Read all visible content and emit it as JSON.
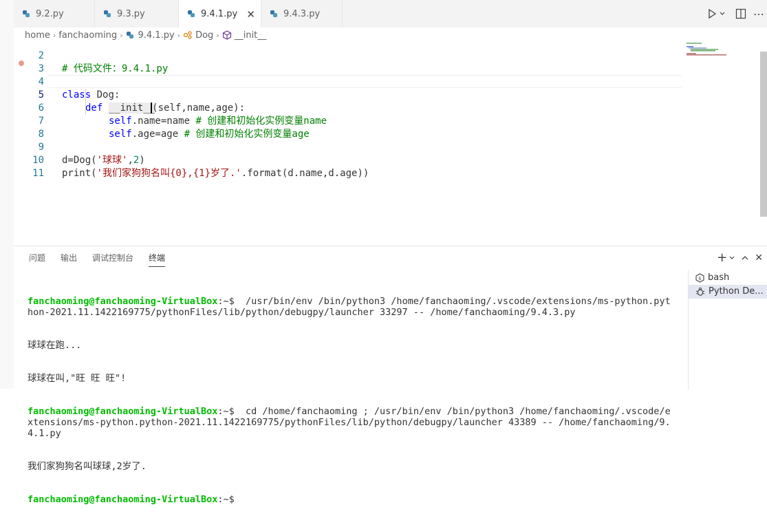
{
  "tabs": [
    {
      "label": "9.2.py",
      "active": false
    },
    {
      "label": "9.3.py",
      "active": false
    },
    {
      "label": "9.4.1.py",
      "active": true
    },
    {
      "label": "9.4.3.py",
      "active": false
    }
  ],
  "breadcrumb": [
    "home",
    "fanchaoming",
    "9.4.1.py",
    "Dog",
    "__init__"
  ],
  "code_lines": [
    {
      "num": "2"
    },
    {
      "num": "3"
    },
    {
      "num": "4"
    },
    {
      "num": "5"
    },
    {
      "num": "6"
    },
    {
      "num": "7"
    },
    {
      "num": "8"
    },
    {
      "num": "9"
    },
    {
      "num": "10"
    },
    {
      "num": "11"
    }
  ],
  "code": {
    "l2": "# 代码文件：9.4.1.py",
    "l4_kw": "class",
    "l4_rest": " Dog:",
    "l5_kw": "def",
    "l5_name": "__init__",
    "l5_rest": "(self,name,age):",
    "l6_self": "self",
    "l6_rest": ".name=name ",
    "l6_cm": "# 创建和初始化实例变量name",
    "l7_self": "self",
    "l7_rest": ".age=age ",
    "l7_cm": "# 创建和初始化实例变量age",
    "l9_a": "d=Dog(",
    "l9_str": "'球球'",
    "l9_b": ",",
    "l9_num": "2",
    "l9_c": ")",
    "l10_a": "print(",
    "l10_str": "'我们家狗狗名叫{0},{1}岁了.'",
    "l10_b": ".format(d.name,d.age))"
  },
  "panel": {
    "tabs": [
      "问题",
      "输出",
      "调试控制台",
      "终端"
    ],
    "active_tab": "终端"
  },
  "terminal": {
    "prompt": "fanchaoming@fanchaoming-VirtualBox",
    "suffix": ":~$",
    "cmd1": "  /usr/bin/env /bin/python3 /home/fanchaoming/.vscode/extensions/ms-python.python-2021.11.1422169775/pythonFiles/lib/python/debugpy/launcher 33297 -- /home/fanchaoming/9.4.3.py",
    "out1": "球球在跑...",
    "out2": "球球在叫,\"旺 旺 旺\"!",
    "cmd2": "  cd /home/fanchaoming ; /usr/bin/env /bin/python3 /home/fanchaoming/.vscode/extensions/ms-python.python-2021.11.1422169775/pythonFiles/lib/python/debugpy/launcher 43389 -- /home/fanchaoming/9.4.1.py",
    "out3": "我们家狗狗名叫球球,2岁了.",
    "cmd3": ""
  },
  "terminal_list": [
    {
      "label": "bash",
      "icon": "bash-icon"
    },
    {
      "label": "Python De...",
      "icon": "debug-icon",
      "selected": true
    }
  ],
  "colors": {
    "prompt": "#00bc00",
    "keyword": "#0000ff",
    "comment": "#008000",
    "string": "#a31515",
    "number": "#098658",
    "line_number": "#237893"
  }
}
